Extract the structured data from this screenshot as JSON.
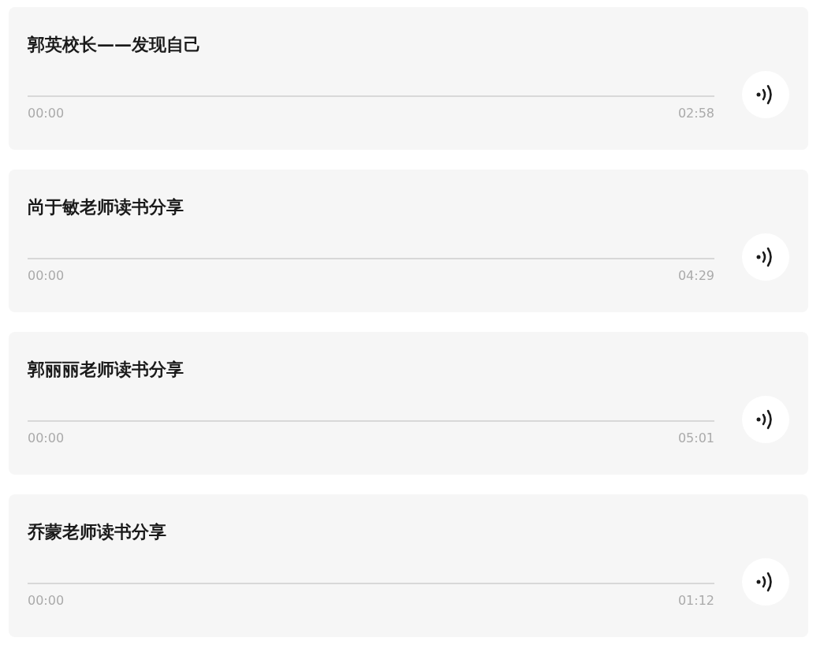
{
  "tracks": [
    {
      "title": "郭英校长——发现自己",
      "progress": {
        "level": 0
      },
      "current_time": "00:00",
      "duration": "02:58"
    },
    {
      "title": "尚于敏老师读书分享",
      "progress": {
        "level": 0
      },
      "current_time": "00:00",
      "duration": "04:29"
    },
    {
      "title": "郭丽丽老师读书分享",
      "progress": {
        "level": 0
      },
      "current_time": "00:00",
      "duration": "05:01"
    },
    {
      "title": "乔蒙老师读书分享",
      "progress": {
        "level": 0
      },
      "current_time": "00:00",
      "duration": "01:12"
    }
  ]
}
